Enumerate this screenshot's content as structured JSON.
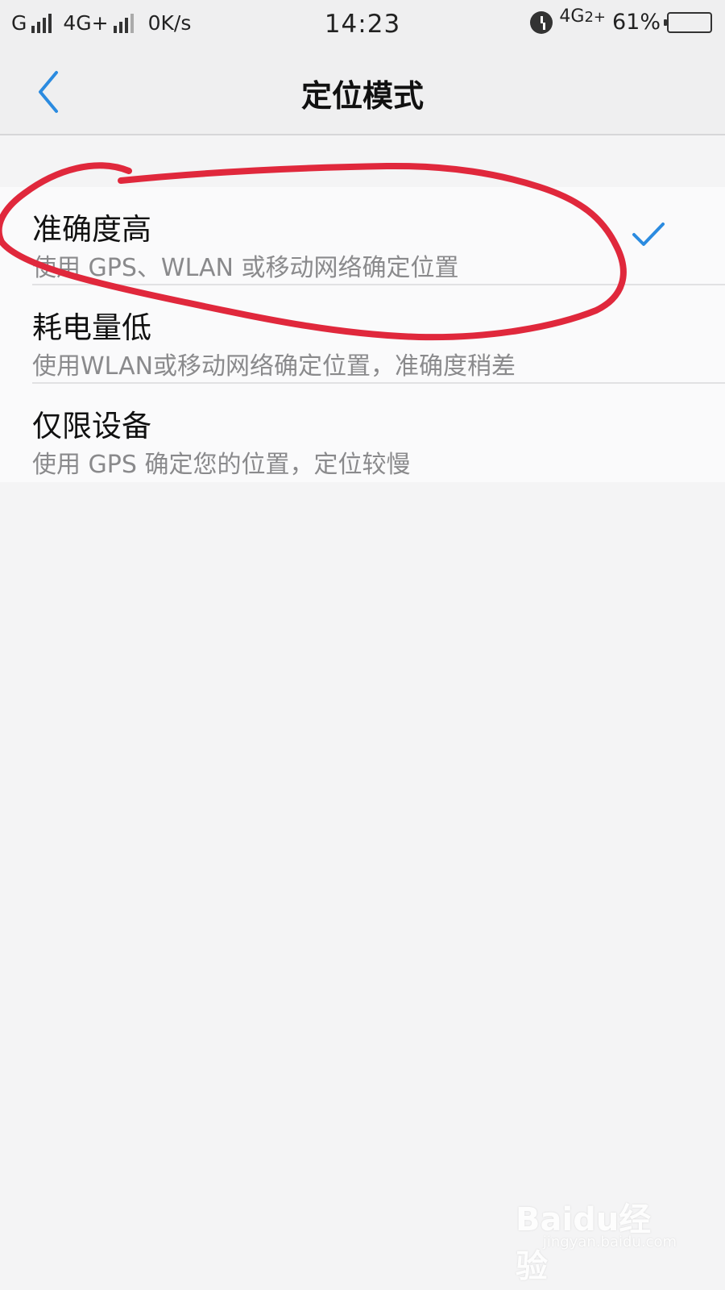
{
  "status_bar": {
    "carrier1": "G",
    "carrier2": "4G+",
    "speed": "0K/s",
    "time": "14:23",
    "net2": "4G",
    "net2_sub": "2+",
    "battery": "61%",
    "battery_level": 0.61,
    "battery_color": "#f2c200"
  },
  "header": {
    "title": "定位模式",
    "back_icon": "chevron-left-icon",
    "accent": "#2b8be0"
  },
  "modes": [
    {
      "title": "准确度高",
      "subtitle": "使用 GPS、WLAN 或移动网络确定位置",
      "selected": true
    },
    {
      "title": "耗电量低",
      "subtitle": "使用WLAN或移动网络确定位置，准确度稍差",
      "selected": false
    },
    {
      "title": "仅限设备",
      "subtitle": "使用 GPS 确定您的位置，定位较慢",
      "selected": false
    }
  ],
  "annotation": {
    "type": "hand-drawn-circle",
    "color": "#e0283c"
  },
  "watermark": {
    "brand": "Baidu经验",
    "url": "jingyan.baidu.com"
  }
}
